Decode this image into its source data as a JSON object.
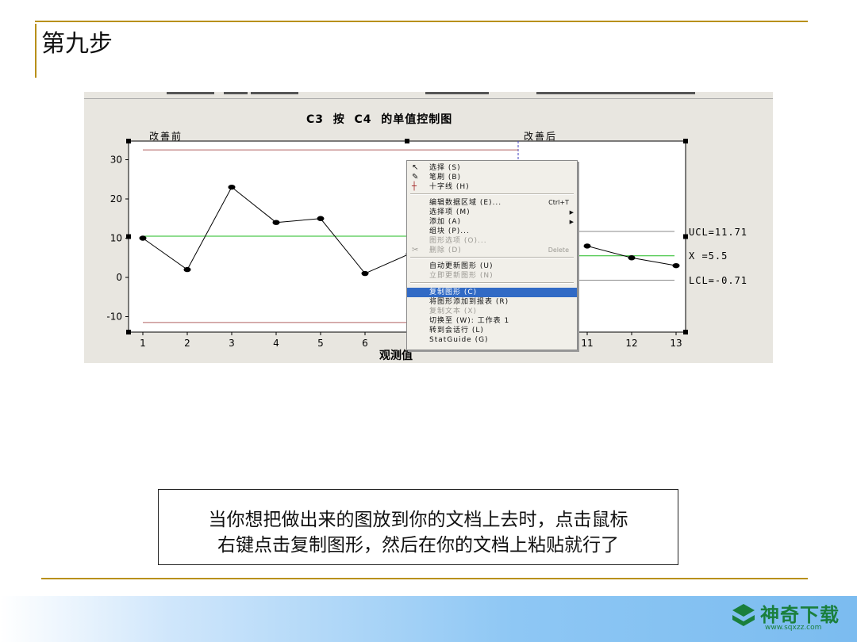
{
  "slide": {
    "title": "第九步"
  },
  "chart_data": {
    "type": "line",
    "title": "C3  按  C4  的单值控制图",
    "xlabel": "观测值",
    "ylabel": "",
    "x": [
      1,
      2,
      3,
      4,
      5,
      6,
      7,
      8,
      9,
      10,
      11,
      12,
      13
    ],
    "x_ticks": [
      "1",
      "2",
      "3",
      "4",
      "5",
      "6",
      "7",
      "8",
      "9",
      "10",
      "11",
      "12",
      "13"
    ],
    "y_ticks": [
      "30",
      "20",
      "10",
      "0",
      "-10"
    ],
    "ylim": [
      -14,
      35
    ],
    "stages": [
      "改善前",
      "改善后"
    ],
    "series": [
      {
        "values": [
          10,
          2,
          23,
          14,
          15,
          1,
          6,
          null,
          null,
          null,
          8,
          5,
          3
        ]
      }
    ],
    "before": {
      "ucl": 32.5,
      "mean": 10.5,
      "lcl": -11.5
    },
    "after": {
      "ucl": 11.71,
      "mean": 5.5,
      "lcl": -0.71
    },
    "control_labels": {
      "ucl": "UCL=11.71",
      "mean": "X =5.5",
      "lcl": "LCL=-0.71"
    },
    "colors": {
      "limit": "#b06060",
      "mean": "#22bb22",
      "after_limit": "#8a8a8a",
      "point": "#000000"
    }
  },
  "context_menu": {
    "items": [
      {
        "label": "选择 (S)",
        "icon": "cursor-arrow-icon",
        "state": "normal"
      },
      {
        "label": "笔刷 (B)",
        "icon": "brush-icon",
        "state": "normal"
      },
      {
        "label": "十字线 (H)",
        "icon": "crosshair-icon",
        "state": "normal"
      },
      {
        "label": "编辑数据区域 (E)...",
        "shortcut": "Ctrl+T",
        "state": "normal"
      },
      {
        "label": "选择项 (M)",
        "submenu": true,
        "state": "normal"
      },
      {
        "label": "添加 (A)",
        "submenu": true,
        "state": "normal"
      },
      {
        "label": "组块 (P)...",
        "state": "normal"
      },
      {
        "label": "图形选项 (O)...",
        "state": "disabled"
      },
      {
        "label": "删除 (D)",
        "shortcut": "Delete",
        "icon": "scissors-icon",
        "state": "disabled"
      },
      {
        "label": "自动更新图形 (U)",
        "state": "normal"
      },
      {
        "label": "立即更新图形 (N)",
        "state": "disabled"
      },
      {
        "label": "复制图形 (C)",
        "state": "selected"
      },
      {
        "label": "将图形添加到报表 (R)",
        "state": "normal"
      },
      {
        "label": "复制文本 (X)",
        "state": "disabled"
      },
      {
        "label": "切换至 (W): 工作表 1",
        "state": "normal"
      },
      {
        "label": "转到会话行 (L)",
        "state": "normal"
      },
      {
        "label": "StatGuide (G)",
        "state": "normal"
      }
    ]
  },
  "caption": {
    "line1": "当你想把做出来的图放到你的文档上去时，点击鼠标",
    "line2": "右键点击复制图形，然后在你的文档上粘贴就行了"
  },
  "footer": {
    "logo_text": "神奇下载",
    "logo_url": "www.sqxzz.com"
  }
}
